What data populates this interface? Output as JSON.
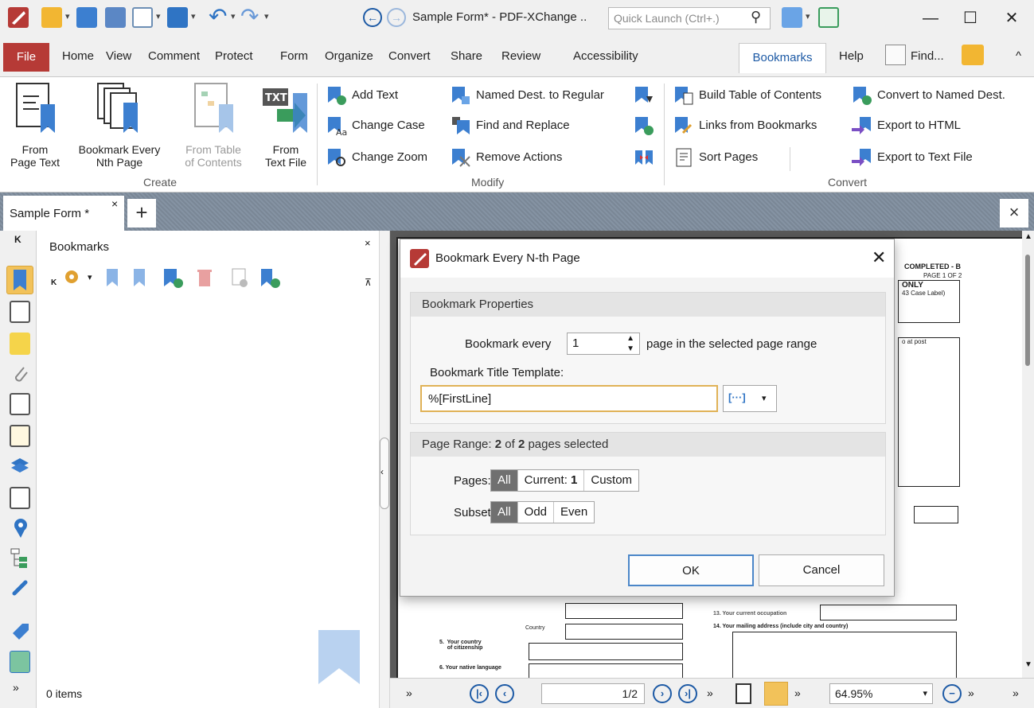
{
  "titlebar": {
    "title": "Sample Form* - PDF-XChange ..",
    "quick_launch_placeholder": "Quick Launch (Ctrl+.)",
    "minimize": "—",
    "maximize": "☐",
    "close": "✕"
  },
  "menu": {
    "file": "File",
    "items": [
      "Home",
      "View",
      "Comment",
      "Protect",
      "Form",
      "Organize",
      "Convert",
      "Share",
      "Review",
      "Accessibility"
    ],
    "active": "Bookmarks",
    "help": "Help",
    "find": "Find...",
    "collapse": "^"
  },
  "ribbon": {
    "create": {
      "label": "Create",
      "from_page_text": [
        "From",
        "Page Text"
      ],
      "bookmark_every": [
        "Bookmark Every",
        "Nth Page"
      ],
      "from_toc": [
        "From Table",
        "of Contents"
      ],
      "from_text_file": [
        "From",
        "Text File"
      ]
    },
    "modify": {
      "label": "Modify",
      "add_text": "Add Text",
      "change_case": "Change Case",
      "change_zoom": "Change Zoom",
      "named_dest_regular": "Named Dest. to Regular",
      "find_replace": "Find and Replace",
      "remove_actions": "Remove Actions"
    },
    "convert": {
      "label": "Convert",
      "build_toc": "Build Table of Contents",
      "links_from_bookmarks": "Links from Bookmarks",
      "sort_pages": "Sort Pages",
      "convert_named_dest": "Convert to Named Dest.",
      "export_html": "Export to HTML",
      "export_text": "Export to Text File"
    }
  },
  "tabs": {
    "doc_tab": "Sample Form *",
    "doc_tab_close": "×",
    "add": "+",
    "close_all": "×"
  },
  "bookmarks_panel": {
    "title": "Bookmarks",
    "close": "×",
    "count": "0 items"
  },
  "dialog": {
    "title": "Bookmark Every N-th Page",
    "close": "✕",
    "properties": {
      "header": "Bookmark Properties",
      "every_label": "Bookmark every",
      "every_value": "1",
      "every_suffix": "page in the selected page range",
      "template_label": "Bookmark Title Template:",
      "template_value": "%[FirstLine]",
      "macro_btn": "[···]"
    },
    "range": {
      "header_prefix": "Page Range: ",
      "selected": "2",
      "of_text": " of ",
      "total": "2",
      "suffix": " pages selected",
      "pages_label": "Pages:",
      "pages_options": [
        "All",
        "Current: 1",
        "Custom"
      ],
      "subset_label": "Subset:",
      "subset_options": [
        "All",
        "Odd",
        "Even"
      ]
    },
    "ok": "OK",
    "cancel": "Cancel"
  },
  "document": {
    "completed": "COMPLETED - B",
    "page_of": "PAGE 1 OF 2",
    "only": "ONLY",
    "case_label": "43 Case Label)",
    "at_post": "o at post",
    "country": "Country",
    "country_citizenship": "5.  Your country\n     of citizenship",
    "native_language": "6.  Your native language",
    "current_occupation": "13. Your current occupation",
    "mailing_address": "14. Your mailing address (include city and country)"
  },
  "bottom": {
    "page_value": "1/2",
    "zoom": "64.95%"
  },
  "colors": {
    "accent": "#1d5aa5",
    "file_tab": "#b63a36",
    "icon_blue": "#3c7fd0",
    "focus": "#e0b257"
  }
}
